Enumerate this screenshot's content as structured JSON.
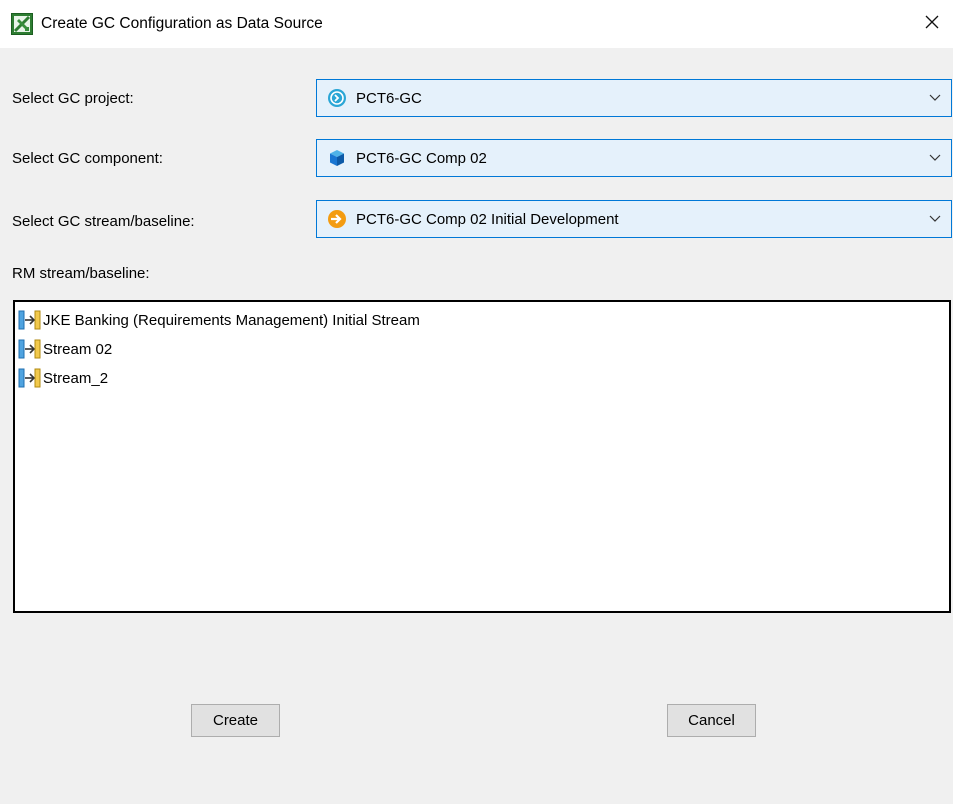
{
  "window": {
    "title": "Create GC Configuration as Data Source",
    "icon": "excel-icon",
    "close_icon": "close-icon"
  },
  "form": {
    "project": {
      "label": "Select GC project:",
      "value": "PCT6-GC",
      "icon": "gc-project-icon"
    },
    "component": {
      "label": "Select GC component:",
      "value": "PCT6-GC Comp 02",
      "icon": "gc-component-icon"
    },
    "stream": {
      "label": "Select GC stream/baseline:",
      "value": "PCT6-GC Comp 02 Initial Development",
      "icon": "gc-stream-icon"
    },
    "rm_label": "RM stream/baseline:",
    "rm_items": [
      "JKE Banking (Requirements Management) Initial Stream",
      "Stream 02",
      "Stream_2"
    ]
  },
  "buttons": {
    "create": "Create",
    "cancel": "Cancel"
  },
  "colors": {
    "combo_bg": "#e5f1fb",
    "combo_border": "#0078d7",
    "dialog_bg": "#f0f0f0",
    "button_bg": "#e1e1e1"
  }
}
